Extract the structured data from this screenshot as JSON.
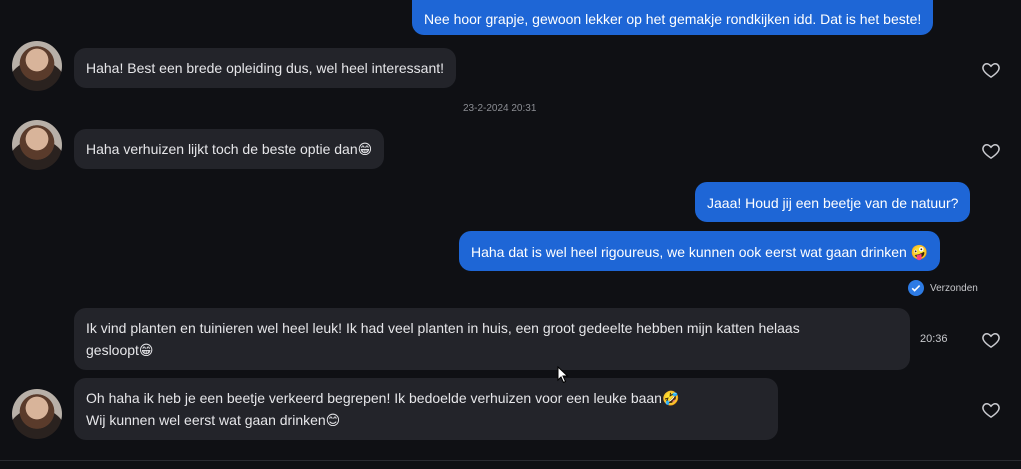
{
  "messages": [
    {
      "id": "m1",
      "dir": "out",
      "text": "Nee hoor grapje, gewoon lekker op het gemakje rondkijken idd. Dat is het beste!"
    },
    {
      "id": "m2",
      "dir": "in",
      "text": "Haha! Best een brede opleiding dus, wel heel interessant!"
    },
    {
      "id": "m3",
      "dir": "in",
      "text": "Haha verhuizen lijkt toch de beste optie dan😁"
    },
    {
      "id": "m4",
      "dir": "out",
      "text": "Jaaa! Houd jij een beetje van de natuur?"
    },
    {
      "id": "m5",
      "dir": "out",
      "text": "Haha dat is wel heel rigoureus, we kunnen ook eerst wat gaan drinken 🤪"
    },
    {
      "id": "m6",
      "dir": "in",
      "line1": "Ik vind planten en tuinieren wel heel leuk! Ik had veel planten in huis, een groot gedeelte hebben mijn katten helaas",
      "line2": "gesloopt😁"
    },
    {
      "id": "m7",
      "dir": "in",
      "line1": "Oh haha ik heb je een beetje verkeerd begrepen! Ik bedoelde verhuizen voor een leuke baan🤣",
      "line2": "Wij kunnen wel eerst wat gaan drinken😊"
    }
  ],
  "timestamp_divider": "23-2-2024 20:31",
  "side_time": "20:36",
  "delivery_status": "Verzonden",
  "icons": {
    "heart": "heart-outline-icon",
    "sent_check": "check-icon",
    "cursor": "mouse-pointer-icon"
  },
  "colors": {
    "background": "#0f1014",
    "incoming_bubble": "#23242a",
    "outgoing_bubble": "#1e66d6",
    "status_badge": "#2d7be5"
  }
}
